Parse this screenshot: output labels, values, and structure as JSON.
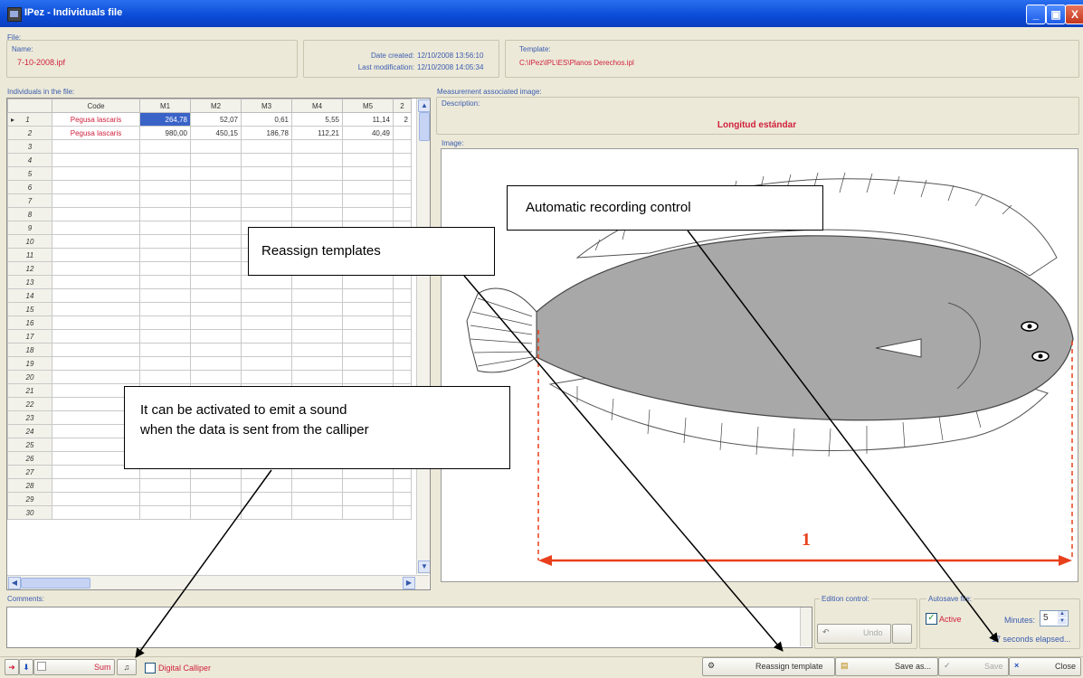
{
  "window": {
    "title": "IPez - Individuals file",
    "min": "_",
    "max": "▣",
    "close": "X"
  },
  "file": {
    "group_label": "File:",
    "name_label": "Name:",
    "name_value": "7-10-2008.ipf",
    "created_label": "Date created:",
    "created_value": "12/10/2008 13:56:10",
    "modified_label": "Last modification:",
    "modified_value": "12/10/2008 14:05:34",
    "template_label": "Template:",
    "template_value": "C:\\IPez\\IPL\\ES\\Planos Derechos.ipl"
  },
  "individuals": {
    "label": "Individuals in the file:",
    "columns": [
      "Code",
      "M1",
      "M2",
      "M3",
      "M4",
      "M5",
      "2"
    ],
    "rows": [
      {
        "n": "1",
        "code": "Pegusa lascaris",
        "m": [
          "264,78",
          "52,07",
          "0,61",
          "5,55",
          "11,14"
        ],
        "extra": "2"
      },
      {
        "n": "2",
        "code": "Pegusa lascaris",
        "m": [
          "980,00",
          "450,15",
          "186,78",
          "112,21",
          "40,49"
        ],
        "extra": ""
      },
      {
        "n": "3"
      },
      {
        "n": "4"
      },
      {
        "n": "5"
      },
      {
        "n": "6"
      },
      {
        "n": "7"
      },
      {
        "n": "8"
      },
      {
        "n": "9"
      },
      {
        "n": "10"
      },
      {
        "n": "11"
      },
      {
        "n": "12"
      },
      {
        "n": "13"
      },
      {
        "n": "14"
      },
      {
        "n": "15"
      },
      {
        "n": "16"
      },
      {
        "n": "17"
      },
      {
        "n": "18"
      },
      {
        "n": "19"
      },
      {
        "n": "20"
      },
      {
        "n": "21"
      },
      {
        "n": "22"
      },
      {
        "n": "23"
      },
      {
        "n": "24"
      },
      {
        "n": "25"
      },
      {
        "n": "26"
      },
      {
        "n": "27"
      },
      {
        "n": "28"
      },
      {
        "n": "29"
      },
      {
        "n": "30"
      }
    ]
  },
  "measurement": {
    "group_label": "Measurement associated image:",
    "description_label": "Description:",
    "description_value": "Longitud estándar",
    "image_label": "Image:",
    "measure_number": "1"
  },
  "comments": {
    "label": "Comments:"
  },
  "edition": {
    "label": "Edition control:",
    "undo": "Undo"
  },
  "autosave": {
    "label": "Autosave file:",
    "active_label": "Active",
    "active_checked": true,
    "minutes_label": "Minutes:",
    "minutes_value": "5",
    "elapsed": "17 seconds elapsed..."
  },
  "bottom": {
    "sum_label": "Sum",
    "calliper_label": "Digital Calliper",
    "reassign_label": "Reassign template",
    "save_as_label": "Save as...",
    "save_label": "Save",
    "close_label": "Close"
  },
  "callouts": {
    "automatic": "Automatic recording control",
    "reassign": "Reassign templates",
    "sound_line1": "It can be activated to emit a sound",
    "sound_line2": "when the data is sent from the calliper"
  },
  "colors": {
    "accent_red": "#d0213c",
    "label_blue": "#3b5cb0",
    "titlebar_blue": "#0a4bd6"
  },
  "icons": [
    "app-icon",
    "minimize-icon",
    "maximize-icon",
    "close-icon",
    "row-pointer-icon",
    "scroll-up-icon",
    "scroll-down-icon",
    "scroll-left-icon",
    "scroll-right-icon",
    "fish-image",
    "undo-icon",
    "spin-up-icon",
    "spin-down-icon",
    "red-arrow-icon",
    "blue-arrow-icon",
    "bell-icon",
    "template-icon",
    "folder-icon",
    "check-icon",
    "close-x-icon"
  ]
}
